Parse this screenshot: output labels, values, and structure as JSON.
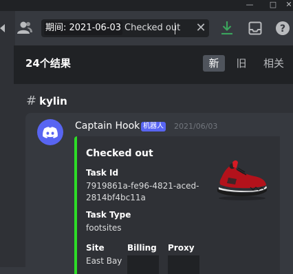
{
  "toolbar": {
    "search": {
      "filter_chip": "期间: 2021-06-03",
      "query": "Checked out"
    }
  },
  "results": {
    "count_label": "24个结果",
    "sort_tabs": [
      {
        "label": "新",
        "active": true
      },
      {
        "label": "旧",
        "active": false
      },
      {
        "label": "相关",
        "active": false
      }
    ],
    "channel": {
      "hash": "#",
      "name": "kylin"
    }
  },
  "message": {
    "author": "Captain Hook",
    "bot_tag": "机器人",
    "timestamp": "2021/06/03",
    "embed": {
      "accent_color": "#2ddc27",
      "title": "Checked out",
      "fields": {
        "task_id": {
          "name": "Task Id",
          "value_line1": "7919861a-fe96-4821-aced-",
          "value_line2": "2814bf4bc11a"
        },
        "task_type": {
          "name": "Task Type",
          "value": "footsites"
        },
        "site": {
          "name": "Site",
          "value": "East Bay"
        },
        "billing": {
          "name": "Billing"
        },
        "proxy": {
          "name": "Proxy"
        }
      },
      "thumbnail": "red-sneaker-image"
    }
  },
  "colors": {
    "brand": "#5865f2",
    "success": "#2ddc27",
    "background": "#36393f"
  }
}
